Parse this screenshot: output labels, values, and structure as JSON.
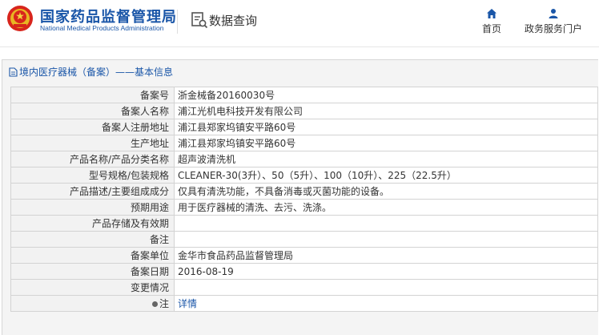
{
  "header": {
    "logo_cn": "国家药品监督管理局",
    "logo_en": "National Medical Products Administration",
    "section_title": "数据查询",
    "nav": {
      "home": "首页",
      "portal": "政务服务门户"
    }
  },
  "breadcrumb": "境内医疗器械（备案）——基本信息",
  "rows": [
    {
      "label": "备案号",
      "value": "浙金械备20160030号"
    },
    {
      "label": "备案人名称",
      "value": "浦江光机电科技开发有限公司"
    },
    {
      "label": "备案人注册地址",
      "value": "浦江县郑家坞镇安平路60号"
    },
    {
      "label": "生产地址",
      "value": "浦江县郑家坞镇安平路60号"
    },
    {
      "label": "产品名称/产品分类名称",
      "value": "超声波清洗机"
    },
    {
      "label": "型号规格/包装规格",
      "value": "CLEANER-30(3升）、50（5升）、100（10升）、225（22.5升）"
    },
    {
      "label": "产品描述/主要组成成分",
      "value": "仅具有清洗功能，不具备消毒或灭菌功能的设备。"
    },
    {
      "label": "预期用途",
      "value": "用于医疗器械的清洗、去污、洗涤。"
    },
    {
      "label": "产品存储及有效期",
      "value": ""
    },
    {
      "label": "备注",
      "value": ""
    },
    {
      "label": "备案单位",
      "value": "金华市食品药品监督管理局"
    },
    {
      "label": "备案日期",
      "value": "2016-08-19"
    },
    {
      "label": "变更情况",
      "value": ""
    }
  ],
  "note_row": {
    "label": "注",
    "link": "详情"
  }
}
